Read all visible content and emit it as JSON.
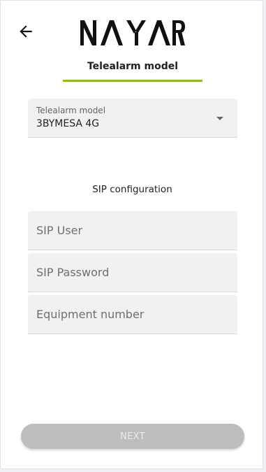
{
  "header": {
    "back_icon": "arrow-left-icon",
    "brand": "NAYAR"
  },
  "tab": {
    "label": "Telealarm model",
    "accent_color": "#8dbb1f"
  },
  "model_select": {
    "label": "Telealarm model",
    "value": "3BYMESA 4G",
    "icon": "chevron-down-icon"
  },
  "sip": {
    "title": "SIP configuration",
    "user_placeholder": "SIP User",
    "password_placeholder": "SIP Password",
    "equipment_placeholder": "Equipment number"
  },
  "footer": {
    "next_label": "NEXT",
    "next_disabled": true
  }
}
